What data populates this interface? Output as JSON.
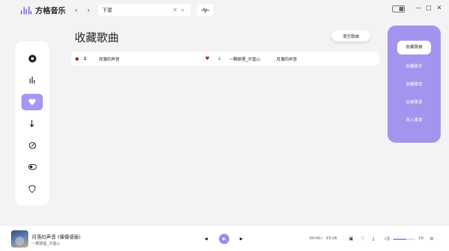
{
  "app": {
    "name": "方格音乐"
  },
  "search": {
    "value": "下潜",
    "placeholder": ""
  },
  "window": {
    "minimize": "—",
    "maximize": "□",
    "close": "✕"
  },
  "page": {
    "title": "收藏歌曲",
    "clear_button": "清空歌曲"
  },
  "songs": [
    {
      "index": "1",
      "title": "月落的声音",
      "artist": "一颗狼星_许篮心",
      "album": "月落的声音",
      "liked": true
    }
  ],
  "right_nav": {
    "items": [
      {
        "label": "收藏歌曲",
        "active": true
      },
      {
        "label": "收藏歌手",
        "active": false
      },
      {
        "label": "收藏歌单",
        "active": false
      },
      {
        "label": "自建歌单",
        "active": false
      },
      {
        "label": "导入歌单",
        "active": false
      }
    ]
  },
  "left_nav": {
    "items": [
      {
        "icon": "disc-icon",
        "active": false
      },
      {
        "icon": "chart-bars-icon",
        "active": false
      },
      {
        "icon": "heart-icon",
        "active": true
      },
      {
        "icon": "download-icon",
        "active": false
      },
      {
        "icon": "compass-icon",
        "active": false
      },
      {
        "icon": "toggle-icon",
        "active": false
      },
      {
        "icon": "shield-icon",
        "active": false
      }
    ]
  },
  "player": {
    "title": "月落的声音 (傈僳语版)",
    "artist": "一颗狼星_许篮心",
    "current_time": "00:00",
    "separator": "/",
    "duration": "03:26",
    "volume": 0.6,
    "volume_label": "10"
  },
  "colors": {
    "accent": "#a494ee",
    "accent_dark": "#6a5ae0",
    "like": "#b02222"
  }
}
